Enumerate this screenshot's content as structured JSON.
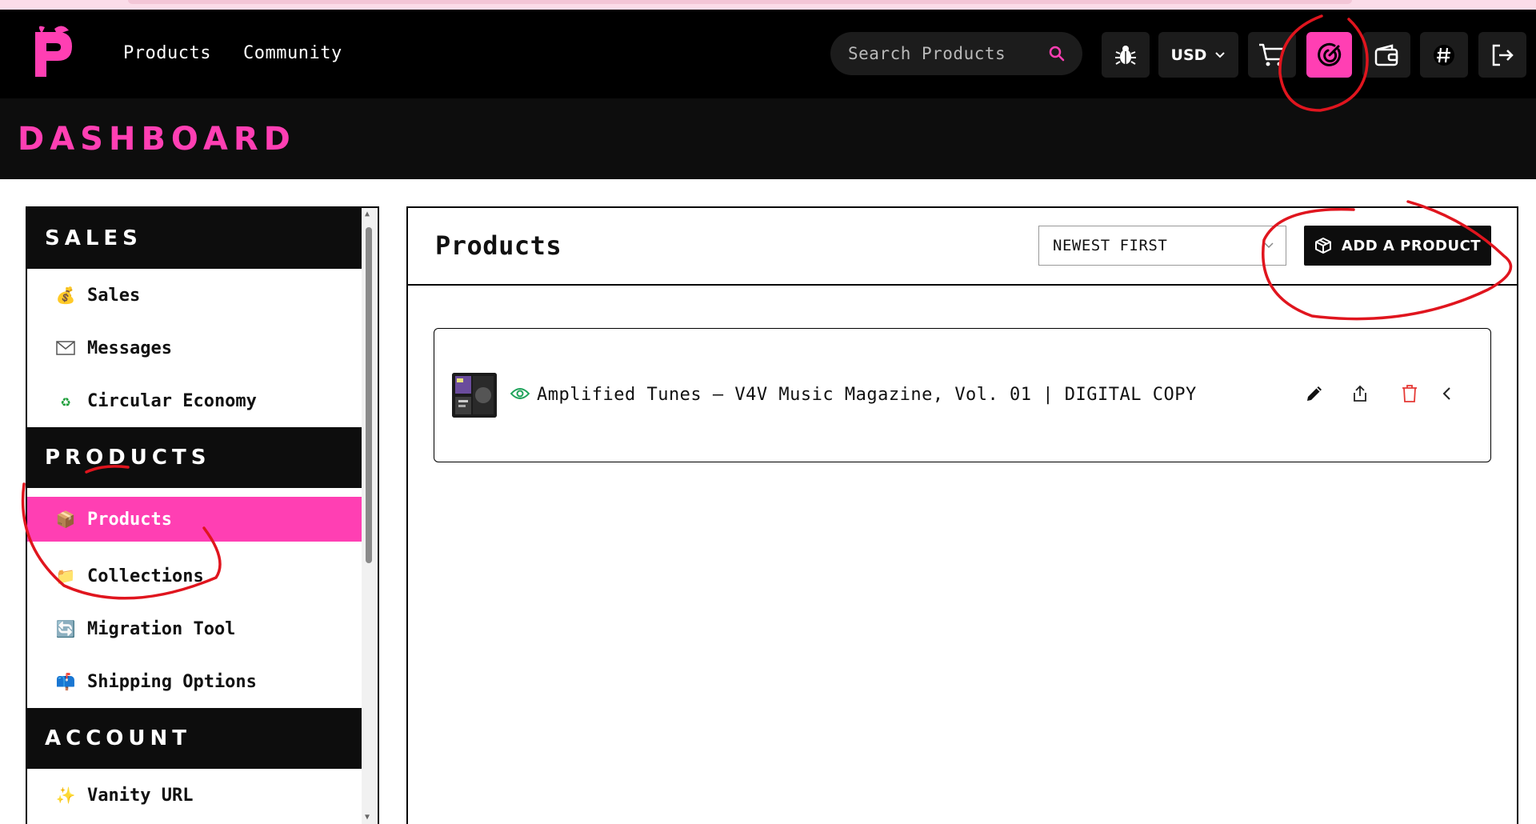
{
  "header": {
    "nav": [
      "Products",
      "Community"
    ],
    "search_placeholder": "Search Products",
    "currency": "USD"
  },
  "page_title": "DASHBOARD",
  "sidebar": {
    "sales": {
      "title": "SALES",
      "items": [
        {
          "label": "Sales",
          "icon": "money-bag-icon"
        },
        {
          "label": "Messages",
          "icon": "envelope-icon"
        },
        {
          "label": "Circular Economy",
          "icon": "recycle-icon"
        }
      ]
    },
    "products": {
      "title": "PRODUCTS",
      "items": [
        {
          "label": "Products",
          "icon": "package-icon",
          "active": true
        },
        {
          "label": "Collections",
          "icon": "folder-icon"
        },
        {
          "label": "Migration Tool",
          "icon": "refresh-icon"
        },
        {
          "label": "Shipping Options",
          "icon": "mailbox-icon"
        }
      ]
    },
    "account": {
      "title": "ACCOUNT",
      "items": [
        {
          "label": "Vanity URL",
          "icon": "sparkles-icon"
        }
      ]
    }
  },
  "main": {
    "title": "Products",
    "sort_value": "NEWEST FIRST",
    "add_button": "ADD A PRODUCT",
    "products": [
      {
        "name": "Amplified Tunes – V4V Music Magazine, Vol. 01 | DIGITAL COPY"
      }
    ]
  },
  "colors": {
    "accent": "#ff3fb3",
    "header_bg": "#000000",
    "annotation": "#e0151e"
  }
}
